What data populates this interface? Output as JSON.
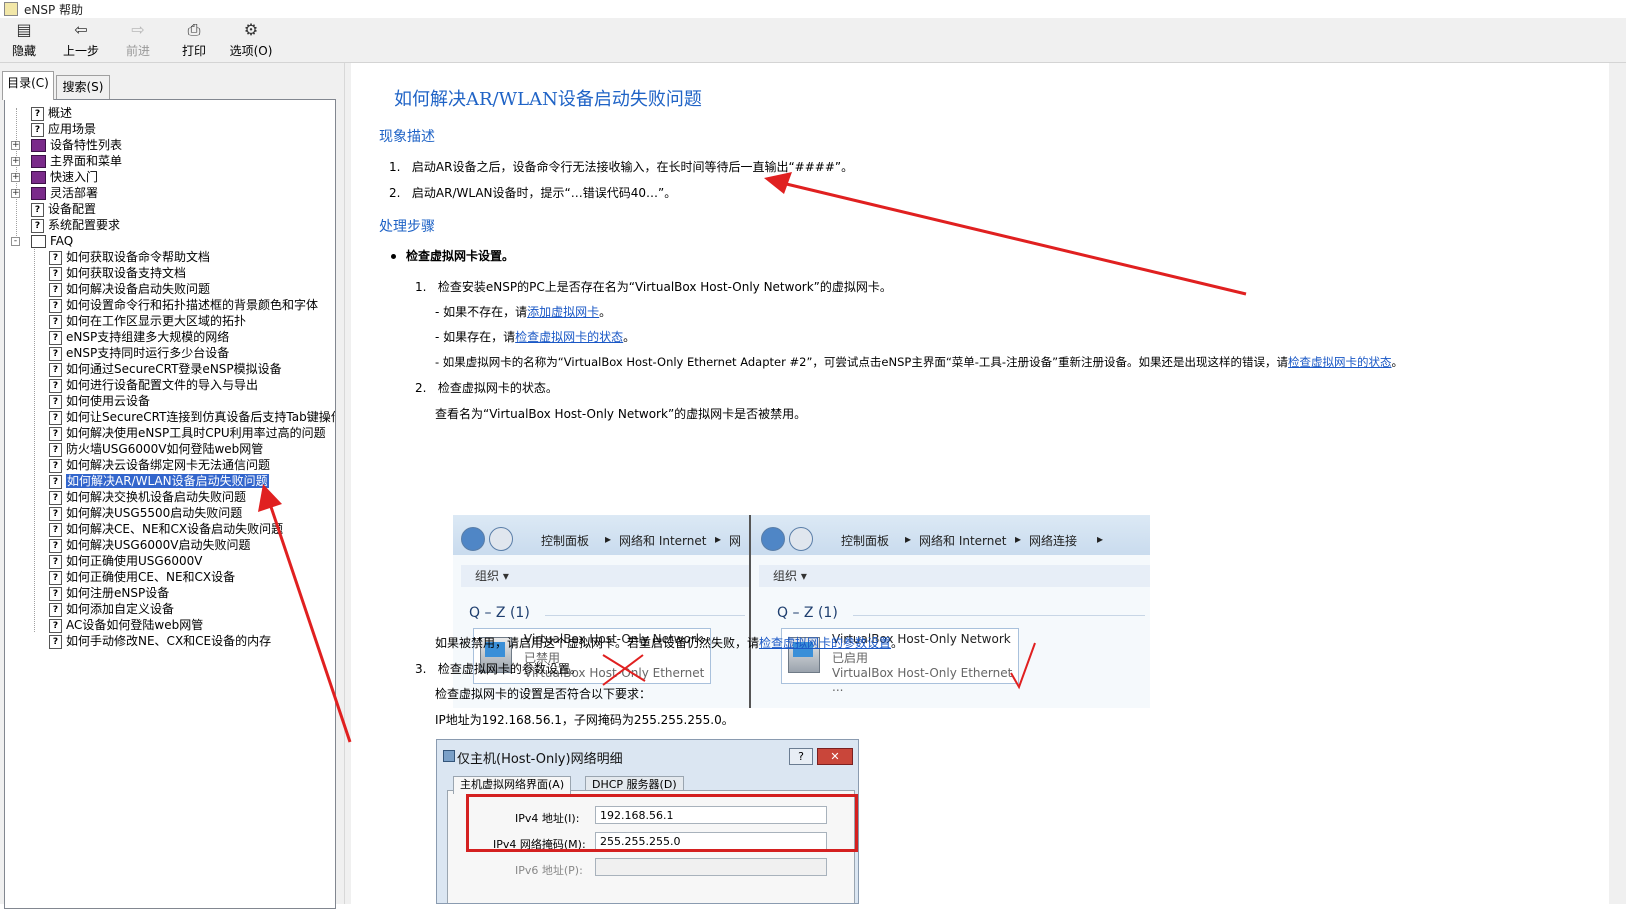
{
  "window": {
    "title": "eNSP 帮助"
  },
  "toolbar": {
    "buttons": [
      {
        "label": "隐藏",
        "icon": "hide-icon"
      },
      {
        "label": "上一步",
        "icon": "back-arrow-icon"
      },
      {
        "label": "前进",
        "icon": "forward-arrow-icon",
        "disabled": true
      },
      {
        "label": "打印",
        "icon": "printer-icon"
      },
      {
        "label": "选项(O)",
        "icon": "options-icon"
      }
    ]
  },
  "sidebar": {
    "tabs": [
      {
        "label": "目录(C)",
        "active": true
      },
      {
        "label": "搜索(S)",
        "active": false
      }
    ],
    "tree": [
      {
        "label": "概述",
        "icon": "help-page-icon",
        "level": 1
      },
      {
        "label": "应用场景",
        "icon": "help-page-icon",
        "level": 1
      },
      {
        "label": "设备特性列表",
        "icon": "book-icon",
        "level": 1,
        "expander": "+"
      },
      {
        "label": "主界面和菜单",
        "icon": "book-icon",
        "level": 1,
        "expander": "+"
      },
      {
        "label": "快速入门",
        "icon": "book-icon",
        "level": 1,
        "expander": "+"
      },
      {
        "label": "灵活部署",
        "icon": "book-icon",
        "level": 1,
        "expander": "+"
      },
      {
        "label": "设备配置",
        "icon": "help-page-icon",
        "level": 1
      },
      {
        "label": "系统配置要求",
        "icon": "help-page-icon",
        "level": 1
      },
      {
        "label": "FAQ",
        "icon": "open-book-icon",
        "level": 1,
        "expander": "-"
      },
      {
        "label": "如何获取设备命令帮助文档",
        "icon": "help-page-icon",
        "level": 2
      },
      {
        "label": "如何获取设备支持文档",
        "icon": "help-page-icon",
        "level": 2
      },
      {
        "label": "如何解决设备启动失败问题",
        "icon": "help-page-icon",
        "level": 2
      },
      {
        "label": "如何设置命令行和拓扑描述框的背景颜色和字体",
        "icon": "help-page-icon",
        "level": 2
      },
      {
        "label": "如何在工作区显示更大区域的拓扑",
        "icon": "help-page-icon",
        "level": 2
      },
      {
        "label": "eNSP支持组建多大规模的网络",
        "icon": "help-page-icon",
        "level": 2
      },
      {
        "label": "eNSP支持同时运行多少台设备",
        "icon": "help-page-icon",
        "level": 2
      },
      {
        "label": "如何通过SecureCRT登录eNSP模拟设备",
        "icon": "help-page-icon",
        "level": 2
      },
      {
        "label": "如何进行设备配置文件的导入与导出",
        "icon": "help-page-icon",
        "level": 2
      },
      {
        "label": "如何使用云设备",
        "icon": "help-page-icon",
        "level": 2
      },
      {
        "label": "如何让SecureCRT连接到仿真设备后支持Tab键操作",
        "icon": "help-page-icon",
        "level": 2
      },
      {
        "label": "如何解决使用eNSP工具时CPU利用率过高的问题",
        "icon": "help-page-icon",
        "level": 2
      },
      {
        "label": "防火墙USG6000V如何登陆web网管",
        "icon": "help-page-icon",
        "level": 2
      },
      {
        "label": "如何解决云设备绑定网卡无法通信问题",
        "icon": "help-page-icon",
        "level": 2
      },
      {
        "label": "如何解决AR/WLAN设备启动失败问题",
        "icon": "help-page-icon",
        "level": 2,
        "selected": true
      },
      {
        "label": "如何解决交换机设备启动失败问题",
        "icon": "help-page-icon",
        "level": 2
      },
      {
        "label": "如何解决USG5500启动失败问题",
        "icon": "help-page-icon",
        "level": 2
      },
      {
        "label": "如何解决CE、NE和CX设备启动失败问题",
        "icon": "help-page-icon",
        "level": 2
      },
      {
        "label": "如何解决USG6000V启动失败问题",
        "icon": "help-page-icon",
        "level": 2
      },
      {
        "label": "如何正确使用USG6000V",
        "icon": "help-page-icon",
        "level": 2
      },
      {
        "label": "如何正确使用CE、NE和CX设备",
        "icon": "help-page-icon",
        "level": 2
      },
      {
        "label": "如何注册eNSP设备",
        "icon": "help-page-icon",
        "level": 2
      },
      {
        "label": "如何添加自定义设备",
        "icon": "help-page-icon",
        "level": 2
      },
      {
        "label": "AC设备如何登陆web网管",
        "icon": "help-page-icon",
        "level": 2
      },
      {
        "label": "如何手动修改NE、CX和CE设备的内存",
        "icon": "help-page-icon",
        "level": 2
      }
    ]
  },
  "article": {
    "title": "如何解决AR/WLAN设备启动失败问题",
    "section1": "现象描述",
    "symptoms": [
      "启动AR设备之后，设备命令行无法接收输入，在长时间等待后一直输出“####”。",
      "启动AR/WLAN设备时，提示“…错误代码40…”。"
    ],
    "section2": "处理步骤",
    "step_heading": "检查虚拟网卡设置。",
    "steps": {
      "s1": {
        "num": "1.",
        "text": "检查安装eNSP的PC上是否存在名为“VirtualBox Host-Only Network”的虚拟网卡。",
        "sub1_pre": "- 如果不存在，请",
        "sub1_link": "添加虚拟网卡",
        "sub1_post": "。",
        "sub2_pre": "- 如果存在，请",
        "sub2_link": "检查虚拟网卡的状态",
        "sub2_post": "。",
        "sub3_pre": "- 如果虚拟网卡的名称为“VirtualBox Host-Only Ethernet Adapter #2”，可尝试点击eNSP主界面“菜单-工具-注册设备”重新注册设备。如果还是出现这样的错误，请",
        "sub3_link": "检查虚拟网卡的状态",
        "sub3_post": "。"
      },
      "s2": {
        "num": "2.",
        "text": "检查虚拟网卡的状态。",
        "desc": "查看名为“VirtualBox Host-Only Network”的虚拟网卡是否被禁用。",
        "after_pre": "如果被禁用，请启用这个虚拟网卡。若重启设备仍然失败，请",
        "after_link": "检查虚拟网卡的参数设置",
        "after_post": "。"
      },
      "s3": {
        "num": "3.",
        "text": "检查虚拟网卡的参数设置。",
        "desc": "检查虚拟网卡的设置是否符合以下要求：",
        "ip_line": "IP地址为192.168.56.1，子网掩码为255.255.255.0。"
      }
    }
  },
  "explorer_left": {
    "crumbs": [
      "控制面板",
      "网络和 Internet",
      "网"
    ],
    "org_label": "组织 ▾",
    "group": "Q – Z (1)",
    "adapter_name": "VirtualBox Host-Only Network",
    "adapter_status": "已禁用",
    "adapter_device": "VirtualBox Host-Only Ethernet ..."
  },
  "explorer_right": {
    "crumbs": [
      "控制面板",
      "网络和 Internet",
      "网络连接"
    ],
    "org_label": "组织 ▾",
    "group": "Q – Z (1)",
    "adapter_name": "VirtualBox Host-Only Network",
    "adapter_status": "已启用",
    "adapter_device": "VirtualBox Host-Only Ethernet ..."
  },
  "dialog": {
    "title": "仅主机(Host-Only)网络明细",
    "help_btn": "?",
    "close_btn": "✕",
    "tabs": [
      "主机虚拟网络界面(A)",
      "DHCP 服务器(D)"
    ],
    "fields": [
      {
        "label": "IPv4 地址(I):",
        "value": "192.168.56.1"
      },
      {
        "label": "IPv4 网络掩码(M):",
        "value": "255.255.255.0"
      },
      {
        "label": "IPv6 地址(P):",
        "value": ""
      }
    ]
  },
  "colors": {
    "link": "#1a58c6",
    "heading": "#1f63c6",
    "annotation": "#e02020",
    "selection": "#3366cc"
  }
}
